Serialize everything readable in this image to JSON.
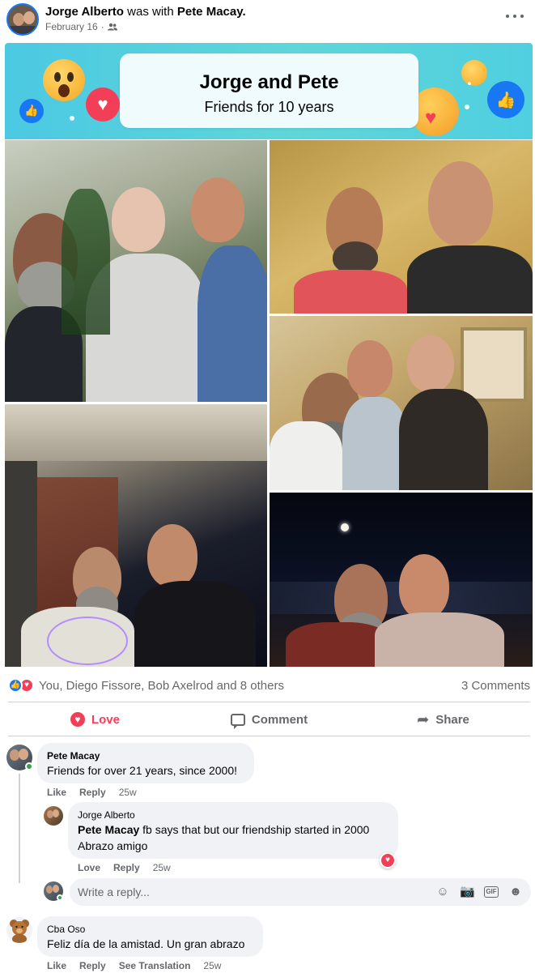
{
  "post": {
    "author": "Jorge Alberto",
    "with_text": "was with",
    "tagged": "Pete Macay.",
    "date": "February 16",
    "separator": "·",
    "audience_icon": "friends-icon"
  },
  "banner": {
    "title": "Jorge and Pete",
    "subtitle": "Friends for 10 years",
    "colors": {
      "gradient_start": "#4bc9e3",
      "gradient_end": "#4fcfe0"
    }
  },
  "reactions": {
    "types": [
      "like",
      "love"
    ],
    "summary": "You, Diego Fissore, Bob Axelrod and 8 others",
    "comments": "3 Comments"
  },
  "actions": {
    "love": "Love",
    "comment": "Comment",
    "share": "Share"
  },
  "comments": [
    {
      "author": "Pete Macay",
      "text": "Friends for over 21 years, since 2000!",
      "like": "Like",
      "reply": "Reply",
      "time": "25w",
      "online": true
    },
    {
      "author": "Jorge Alberto",
      "mention": "Pete Macay",
      "text_line1": "fb says that but our friendship started in 2000",
      "text_line2": "Abrazo amigo",
      "like": "Love",
      "reply": "Reply",
      "time": "25w",
      "reaction": "love"
    },
    {
      "author": "Cba Oso",
      "text": "Feliz día de la amistad. Un gran abrazo",
      "like": "Like",
      "reply": "Reply",
      "translate": "See Translation",
      "time": "25w"
    }
  ],
  "reply_box": {
    "placeholder": "Write a reply...",
    "tools": [
      "emoji-icon",
      "camera-icon",
      "gif-icon",
      "sticker-icon"
    ]
  },
  "colors": {
    "accent": "#1877f2",
    "love": "#f33e58",
    "muted": "#65676b",
    "bubble": "#f0f2f5"
  }
}
